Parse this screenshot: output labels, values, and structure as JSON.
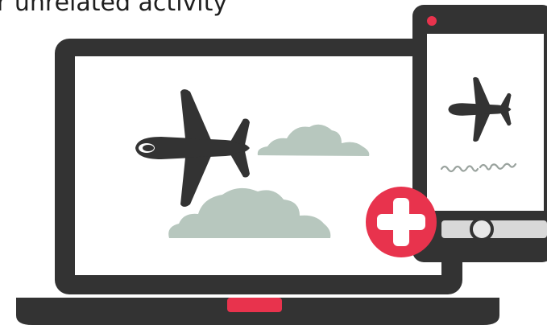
{
  "caption": {
    "text": "r unrelated activity"
  },
  "phone_screen": {
    "handwriting_alt": "scribbled handwriting"
  },
  "colors": {
    "frame": "#333333",
    "screen": "#ffffff",
    "cloud": "#b7c7be",
    "accent": "#e8334d",
    "plus": "#ffffff",
    "home_bar": "#d8d8d8",
    "phone_button": "#e8e8e8"
  },
  "icons": {
    "plane": "airplane-icon",
    "cloud": "cloud-icon",
    "plus": "plus-icon",
    "phone_button": "home-button-icon",
    "camera": "camera-dot-icon"
  }
}
